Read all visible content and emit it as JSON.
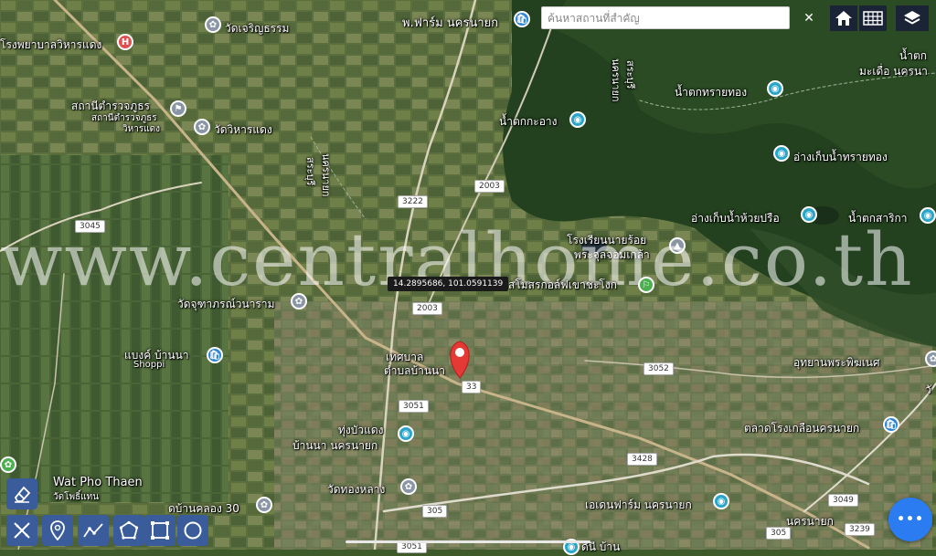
{
  "search": {
    "placeholder": "ค้นหาสถานที่สำคัญ",
    "clear": "✕"
  },
  "top_buttons": [
    {
      "icon": "home-icon"
    },
    {
      "icon": "grid-icon"
    },
    {
      "icon": "layers-icon"
    }
  ],
  "watermark": "www.centralhome.co.th",
  "coordinate_readout": "14.2895686, 101.0591139",
  "labels": {
    "hospital": "โรงพยาบาลวิหารแดง",
    "wat_charoen": "วัดเจริญธรรม",
    "pharm": "พ.ฟาร์ม นครนายก",
    "police_1": "สถานีตำรวจภูธร",
    "police_2": "สถานีตำรวจภูธร",
    "police_3": "วิหารแดง",
    "wat_viharn": "วัดวิหารแดง",
    "saraburi_1": "สระบุรี",
    "nakhon_1": "นครนายก",
    "saraburi_2": "สระบุรี",
    "nakhon_2": "นครนายก",
    "waterfall_kaoang": "น้ำตกกะอาง",
    "waterfall_saithong": "น้ำตกทรายทอง",
    "waterfall_top": "น้ำตก",
    "madua": "มะเดื่อ นครนา",
    "reservoir_saithong": "อ่างเก็บน้ำทรายทอง",
    "reservoir_huaipreu": "อ่างเก็บน้ำห้วยปรือ",
    "waterfall_sarika": "น้ำตกสาริกา",
    "school_1": "โรงเรียนนายร้อย",
    "school_2": "พระจุลจอมเกล้า",
    "golf": "สโมสรกอล์ฟเขาชะโงก",
    "wat_chuttha": "วัดจุฑาภรณ์วนาราม",
    "bank_1": "แบงค์ บ้านนา",
    "bank_2": "Shoppi",
    "municipal_1": "เทศบาล",
    "municipal_2": "ตำบลบ้านนา",
    "park": "อุทยานพระพิฆเนศ",
    "market": "ตลาดโรงเกลือนครนายก",
    "thung_1": "ทุ่งบัวแดง",
    "thung_2": "บ้านนา นครนายก",
    "wat_pho_1": "Wat Pho Thaen",
    "wat_pho_2": "วัดโพธิ์แทน",
    "wat_thonglang": "วัดทองหลาง",
    "khlong30": "ดบ้านคลอง 30",
    "eden": "เอเดนฟาร์ม นครนายก",
    "nakhonnayok": "นครนายก",
    "bottom_partial": "ดีนี บ้าน",
    "right_partial": "วั"
  },
  "roads": {
    "r2003a": "2003",
    "r3222": "3222",
    "r3045": "3045",
    "r2003b": "2003",
    "r3052": "3052",
    "r33": "33",
    "r3051a": "3051",
    "r3428": "3428",
    "r305a": "305",
    "r3049": "3049",
    "r3239": "3239",
    "r305b": "305",
    "r3051b": "3051"
  },
  "tools": [
    {
      "icon": "eraser-icon"
    },
    {
      "icon": "measure-icon"
    },
    {
      "icon": "pin-icon"
    },
    {
      "icon": "polyline-icon"
    },
    {
      "icon": "polygon-icon"
    },
    {
      "icon": "rectangle-icon"
    },
    {
      "icon": "circle-icon"
    }
  ],
  "fab_icon": "more-icon",
  "fab_label": "•••",
  "colors": {
    "tool_bg": "#3a5c9a",
    "fab_bg": "#2a7cf0",
    "marker": "#e53935",
    "poi_blue": "#2f86d6",
    "poi_teal": "#29a5c9",
    "poi_gray": "#8a96a6",
    "hospital": "#e05050",
    "golf": "#4caf50"
  }
}
